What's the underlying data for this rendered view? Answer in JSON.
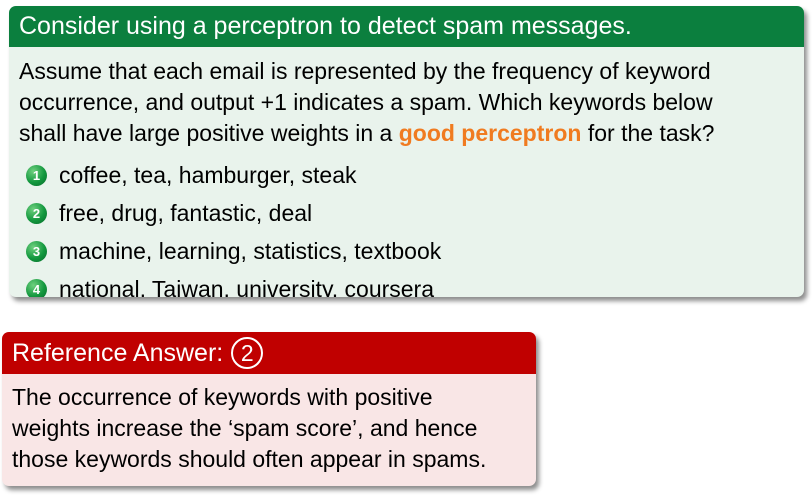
{
  "question": {
    "title": "Consider using a perceptron to detect spam messages.",
    "text_lines": [
      "Assume that each email is represented by the frequency of keyword",
      "occurrence, and output +1 indicates a spam. Which keywords below"
    ],
    "text_line3_before": "shall have large positive weights in a ",
    "text_line3_highlight": "good perceptron",
    "text_line3_after": " for the task?",
    "options": [
      {
        "number": "1",
        "text": "coffee, tea, hamburger, steak"
      },
      {
        "number": "2",
        "text": "free, drug, fantastic, deal"
      },
      {
        "number": "3",
        "text": "machine, learning, statistics, textbook"
      },
      {
        "number": "4",
        "text": "national, Taiwan, university, coursera"
      }
    ]
  },
  "answer": {
    "title": "Reference Answer:",
    "number": "2",
    "lines": [
      "The occurrence of keywords with positive",
      "weights increase the ‘spam score’, and hence",
      "those keywords should often appear in spams."
    ]
  },
  "colors": {
    "question_header": "#0b7f3e",
    "question_body": "#e9f3ec",
    "highlight": "#f07b20",
    "answer_header": "#c00000",
    "answer_body": "#f9e6e6"
  }
}
